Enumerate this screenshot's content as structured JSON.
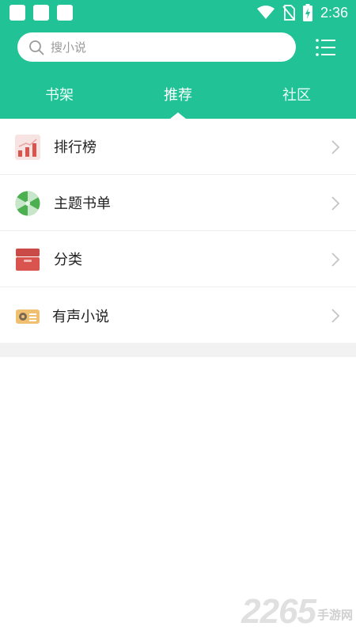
{
  "status_bar": {
    "time": "2:36",
    "icons": [
      "notification-icon",
      "notification-icon",
      "notification-icon",
      "wifi-icon",
      "no-sim-icon",
      "battery-charging-icon"
    ]
  },
  "search": {
    "placeholder": "搜小说",
    "icon": "search-icon"
  },
  "menu_icon": "list-menu-icon",
  "tabs": [
    {
      "label": "书架",
      "active": false
    },
    {
      "label": "推荐",
      "active": true
    },
    {
      "label": "社区",
      "active": false
    }
  ],
  "list": [
    {
      "label": "排行榜",
      "icon": "ranking-chart-icon"
    },
    {
      "label": "主题书单",
      "icon": "candy-swirl-icon"
    },
    {
      "label": "分类",
      "icon": "category-box-icon"
    },
    {
      "label": "有声小说",
      "icon": "radio-icon"
    }
  ],
  "watermark": {
    "number": "2265",
    "text": "手游网"
  },
  "colors": {
    "header": "#20c296",
    "background": "#ffffff",
    "divider": "#eeeeee",
    "chevron": "#c4c4c4"
  }
}
